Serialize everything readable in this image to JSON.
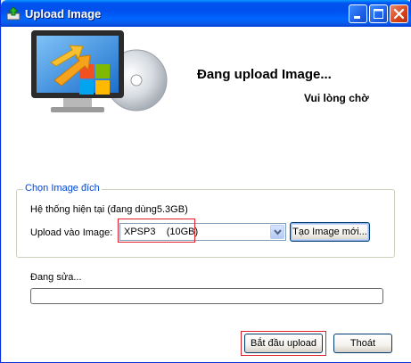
{
  "window": {
    "title": "Upload Image"
  },
  "header": {
    "main_message": "Đang upload Image...",
    "sub_message": "Vui lòng chờ"
  },
  "target_group": {
    "legend": "Chọn Image đích",
    "current_system_label": "Hệ thống hiện tại (đang dùng5.3GB)",
    "upload_to_label": "Upload vào Image:",
    "selected_image": "XPSP3    (10GB)",
    "new_image_button": "Tạo Image mới..."
  },
  "progress": {
    "status_label": "Đang sửa...",
    "fraction": 0
  },
  "footer": {
    "start_button": "Bắt đầu upload",
    "exit_button": "Thoát"
  },
  "colors": {
    "titlebar": "#0054E3",
    "legend": "#0046D5",
    "highlight": "#E0202A"
  },
  "icons": [
    "upload-arrow-icon",
    "minimize-icon",
    "maximize-icon",
    "close-icon",
    "chevron-down-icon"
  ]
}
